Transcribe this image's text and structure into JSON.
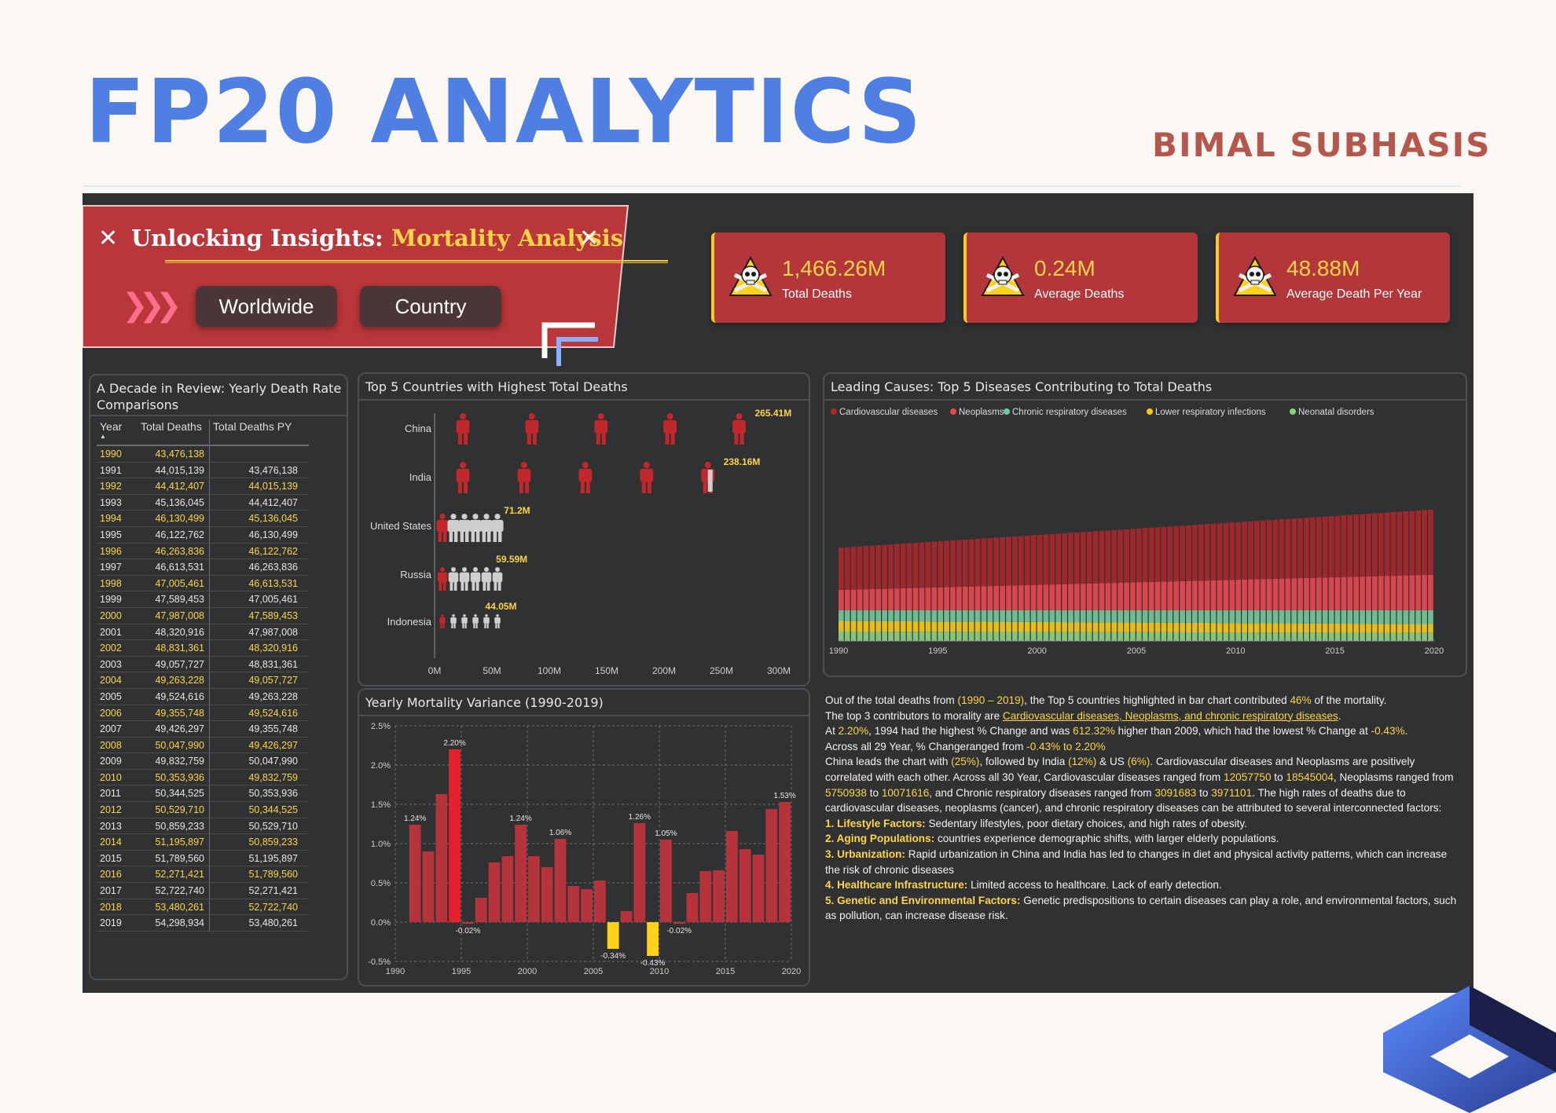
{
  "page": {
    "brand": "FP20 ANALYTICS",
    "author": "BIMAL SUBHASIS"
  },
  "banner": {
    "mark": "✕",
    "title_part1": "Unlocking Insights:",
    "title_part2": "Mortality Analysis",
    "chevrons": "❯❯❯",
    "buttons": [
      "Worldwide",
      "Country"
    ]
  },
  "kpis": [
    {
      "value": "1,466.26M",
      "label": "Total Deaths"
    },
    {
      "value": "0.24M",
      "label": "Average Deaths"
    },
    {
      "value": "48.88M",
      "label": "Average Death Per Year"
    }
  ],
  "table": {
    "title_line1": "A Decade in Review: Yearly Death Rate",
    "title_line2": "Comparisons",
    "sort_indicator": "▲",
    "headers": [
      "Year",
      "Total Deaths",
      "Total Deaths PY"
    ],
    "rows": [
      [
        "1990",
        "43,476,138",
        ""
      ],
      [
        "1991",
        "44,015,139",
        "43,476,138"
      ],
      [
        "1992",
        "44,412,407",
        "44,015,139"
      ],
      [
        "1993",
        "45,136,045",
        "44,412,407"
      ],
      [
        "1994",
        "46,130,499",
        "45,136,045"
      ],
      [
        "1995",
        "46,122,762",
        "46,130,499"
      ],
      [
        "1996",
        "46,263,836",
        "46,122,762"
      ],
      [
        "1997",
        "46,613,531",
        "46,263,836"
      ],
      [
        "1998",
        "47,005,461",
        "46,613,531"
      ],
      [
        "1999",
        "47,589,453",
        "47,005,461"
      ],
      [
        "2000",
        "47,987,008",
        "47,589,453"
      ],
      [
        "2001",
        "48,320,916",
        "47,987,008"
      ],
      [
        "2002",
        "48,831,361",
        "48,320,916"
      ],
      [
        "2003",
        "49,057,727",
        "48,831,361"
      ],
      [
        "2004",
        "49,263,228",
        "49,057,727"
      ],
      [
        "2005",
        "49,524,616",
        "49,263,228"
      ],
      [
        "2006",
        "49,355,748",
        "49,524,616"
      ],
      [
        "2007",
        "49,426,297",
        "49,355,748"
      ],
      [
        "2008",
        "50,047,990",
        "49,426,297"
      ],
      [
        "2009",
        "49,832,759",
        "50,047,990"
      ],
      [
        "2010",
        "50,353,936",
        "49,832,759"
      ],
      [
        "2011",
        "50,344,525",
        "50,353,936"
      ],
      [
        "2012",
        "50,529,710",
        "50,344,525"
      ],
      [
        "2013",
        "50,859,233",
        "50,529,710"
      ],
      [
        "2014",
        "51,195,897",
        "50,859,233"
      ],
      [
        "2015",
        "51,789,560",
        "51,195,897"
      ],
      [
        "2016",
        "52,271,421",
        "51,789,560"
      ],
      [
        "2017",
        "52,722,740",
        "52,271,421"
      ],
      [
        "2018",
        "53,480,261",
        "52,722,740"
      ],
      [
        "2019",
        "54,298,934",
        "53,480,261"
      ]
    ]
  },
  "chart_data": [
    {
      "type": "bar",
      "title": "Top 5 Countries with Highest Total Deaths",
      "orientation": "horizontal",
      "categories": [
        "China",
        "India",
        "United States",
        "Russia",
        "Indonesia"
      ],
      "values": [
        265.41,
        238.16,
        71.2,
        59.59,
        44.05
      ],
      "data_labels": [
        "265.41M",
        "238.16M",
        "71.2M",
        "59.59M",
        "44.05M"
      ],
      "xticks": [
        "0M",
        "50M",
        "100M",
        "150M",
        "200M",
        "250M",
        "300M"
      ],
      "xlim": [
        0,
        300
      ],
      "colors": {
        "filled": "#c0282b",
        "empty": "#cfcfcf"
      }
    },
    {
      "type": "bar",
      "title": "Yearly Mortality Variance (1990-2019)",
      "x": [
        1990,
        1991,
        1992,
        1993,
        1994,
        1995,
        1996,
        1997,
        1998,
        1999,
        2000,
        2001,
        2002,
        2003,
        2004,
        2005,
        2006,
        2007,
        2008,
        2009,
        2010,
        2011,
        2012,
        2013,
        2014,
        2015,
        2016,
        2017,
        2018,
        2019
      ],
      "values": [
        null,
        1.24,
        0.9,
        1.63,
        2.2,
        -0.02,
        0.31,
        0.76,
        0.84,
        1.24,
        0.84,
        0.7,
        1.06,
        0.46,
        0.42,
        0.53,
        -0.34,
        0.14,
        1.26,
        -0.43,
        1.05,
        -0.02,
        0.37,
        0.65,
        0.66,
        1.16,
        0.93,
        0.86,
        1.44,
        1.53
      ],
      "labels": {
        "1991": "1.24%",
        "1994": "2.20%",
        "1995": "-0.02%",
        "1999": "1.24%",
        "2002": "1.06%",
        "2006": "-0.34%",
        "2008": "1.26%",
        "2009": "-0.43%",
        "2010": "1.05%",
        "2011": "-0.02%",
        "2019": "1.53%"
      },
      "yticks": [
        "2.5%",
        "2.0%",
        "1.5%",
        "1.0%",
        "0.5%",
        "0.0%",
        "-0.5%"
      ],
      "xticks": [
        "1990",
        "1995",
        "2000",
        "2005",
        "2010",
        "2015",
        "2020"
      ],
      "ylim": [
        -0.5,
        2.5
      ],
      "highlight": {
        "max_year": 1994,
        "min_years": [
          2006,
          2009
        ]
      },
      "colors": {
        "bar": "#b5333a",
        "max": "#e8202b",
        "min": "#ffd21a"
      }
    },
    {
      "type": "area",
      "title": "Leading Causes: Top 5 Diseases Contributing to Total Deaths",
      "legend_position": "top",
      "series": [
        {
          "name": "Cardiovascular diseases",
          "color": "#a8282e",
          "start": 12057750,
          "end": 18545004
        },
        {
          "name": "Neoplasms",
          "color": "#e8474f",
          "start": 5750938,
          "end": 10071616
        },
        {
          "name": "Chronic respiratory diseases",
          "color": "#74c79c",
          "start": 3091683,
          "end": 3971101
        },
        {
          "name": "Lower respiratory infections",
          "color": "#f5c916"
        },
        {
          "name": "Neonatal disorders",
          "color": "#8fcf80"
        }
      ],
      "x_range": [
        1990,
        2019
      ],
      "xticks": [
        "1990",
        "1995",
        "2000",
        "2005",
        "2010",
        "2015",
        "2020"
      ]
    }
  ],
  "narrative": [
    [
      [
        "t",
        "Out of the total deaths from "
      ],
      [
        "y",
        "(1990 – 2019)"
      ],
      [
        "t",
        ", the Top 5 countries highlighted in bar chart contributed "
      ],
      [
        "y",
        "46%"
      ],
      [
        "t",
        " of the mortality."
      ]
    ],
    [
      [
        "t",
        "The top 3 contributors to morality are "
      ],
      [
        "u",
        "Cardiovascular diseases, Neoplasms, and chronic respiratory diseases"
      ],
      [
        "t",
        "."
      ]
    ],
    [
      [
        "t",
        "At "
      ],
      [
        "y",
        "2.20%"
      ],
      [
        "t",
        ", 1994 had the highest % Change and was "
      ],
      [
        "y",
        "612.32%"
      ],
      [
        "t",
        " higher than 2009, which had the lowest % Change at "
      ],
      [
        "y",
        "-0.43%"
      ],
      [
        "t",
        "."
      ]
    ],
    [
      [
        "t",
        " Across all 29 Year, % Changeranged from "
      ],
      [
        "y",
        "-0.43% to 2.20%"
      ]
    ],
    [
      [
        "t",
        "China leads the chart with "
      ],
      [
        "y",
        "(25%)"
      ],
      [
        "t",
        ", followed by India "
      ],
      [
        "y",
        "(12%)"
      ],
      [
        "t",
        " & US "
      ],
      [
        "y",
        "(6%)"
      ],
      [
        "t",
        ". Cardiovascular diseases and Neoplasms are positively correlated with each other. Across all 30 Year, Cardiovascular diseases ranged from "
      ],
      [
        "y",
        "12057750"
      ],
      [
        "t",
        " to "
      ],
      [
        "y",
        "18545004"
      ],
      [
        "t",
        ", Neoplasms ranged from "
      ],
      [
        "y",
        "5750938"
      ],
      [
        "t",
        " to "
      ],
      [
        "y",
        "10071616"
      ],
      [
        "t",
        ", and Chronic respiratory diseases ranged from "
      ],
      [
        "y",
        "3091683"
      ],
      [
        "t",
        " to "
      ],
      [
        "y",
        "3971101"
      ],
      [
        "t",
        ".  The high rates of deaths due to cardiovascular diseases, neoplasms (cancer), and chronic respiratory diseases can be attributed to several interconnected factors:"
      ]
    ],
    [
      [
        "f",
        "1.  Lifestyle Factors:"
      ],
      [
        "t",
        " Sedentary lifestyles, poor dietary choices, and high rates of obesity."
      ]
    ],
    [
      [
        "f",
        "2. Aging Populations:"
      ],
      [
        "t",
        " countries experience demographic shifts, with larger elderly populations."
      ]
    ],
    [
      [
        "f",
        "3. Urbanization:"
      ],
      [
        "t",
        " Rapid urbanization in China and India has led to changes in diet and physical activity patterns, which can increase the risk of chronic diseases"
      ]
    ],
    [
      [
        "f",
        "4. Healthcare Infrastructure:"
      ],
      [
        "t",
        " Limited access to healthcare. Lack of early detection."
      ]
    ],
    [
      [
        "f",
        "5. Genetic and Environmental Factors:"
      ],
      [
        "t",
        " Genetic predispositions to certain diseases can play a role, and environmental factors, such as pollution, can increase disease risk."
      ]
    ]
  ]
}
